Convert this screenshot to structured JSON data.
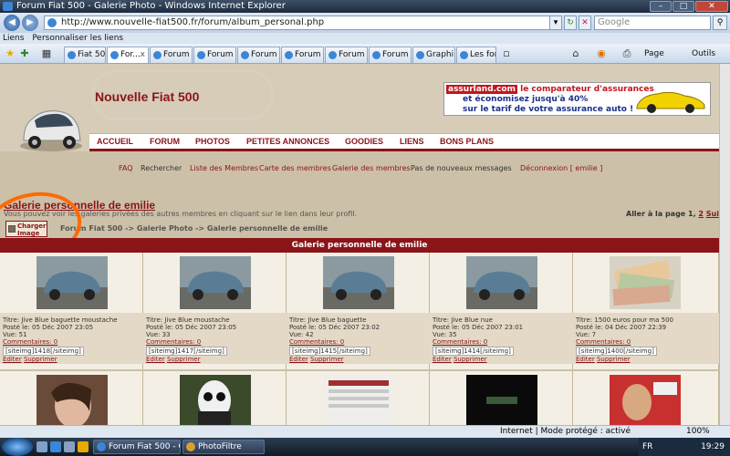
{
  "window": {
    "title": "Forum Fiat 500 - Galerie Photo - Windows Internet Explorer",
    "controls": [
      "–",
      "□",
      "✕"
    ]
  },
  "address": {
    "url": "http://www.nouvelle-fiat500.fr/forum/album_personal.php",
    "search_placeholder": "Google"
  },
  "links_bar": [
    "Liens",
    "Personnaliser les liens"
  ],
  "tabs": [
    {
      "label": "Fiat 50..."
    },
    {
      "label": "For..."
    },
    {
      "label": "Forum ..."
    },
    {
      "label": "Forum ..."
    },
    {
      "label": "Forum ..."
    },
    {
      "label": "Forum ..."
    },
    {
      "label": "Forum ..."
    },
    {
      "label": "Forum ..."
    },
    {
      "label": "Graphi..."
    },
    {
      "label": "Les for..."
    }
  ],
  "toolbar": {
    "page_label": "Page",
    "tools_label": "Outils"
  },
  "site": {
    "logo_text": "Nouvelle Fiat 500",
    "banner": {
      "brand": "assurland",
      "brand_suffix": ".com",
      "line1": "le comparateur d'assurances",
      "line2": "et économisez jusqu'à 40%",
      "line3": "sur le tarif de votre assurance auto !"
    },
    "menu": [
      "ACCUEIL",
      "FORUM",
      "PHOTOS",
      "PETITES ANNONCES",
      "GOODIES",
      "LIENS",
      "BONS PLANS"
    ],
    "submenu": [
      "FAQ",
      "Rechercher",
      "Liste des Membres",
      "Carte des membres",
      "Galerie des membres",
      "Pas de nouveaux messages",
      "Déconnexion [ emilie ]"
    ],
    "gallery": {
      "title": "Galerie personnelle de emilie",
      "description": "Vous pouvez voir les galeries privées des autres membres en cliquant sur le lien dans leur profil.",
      "page_info": "Aller à la page 1,",
      "page_2": "2",
      "next": "Suivante",
      "upload_label": "Charger Image",
      "breadcrumb": "Forum Fiat 500 -> Galerie Photo -> Galerie personnelle de emilie",
      "bar_title": "Galerie personnelle de emilie"
    },
    "photos": [
      {
        "title": "Titre: Jive Blue baguette moustache",
        "posted": "Posté le: 05 Déc 2007 23:05",
        "views": "Vue: 51",
        "comments": "Commentaires: 0",
        "tag": "[siteimg]1418[/siteimg]",
        "edit": "Editer",
        "delete": "Supprimer"
      },
      {
        "title": "Titre: Jive Blue moustache",
        "posted": "Posté le: 05 Déc 2007 23:05",
        "views": "Vue: 33",
        "comments": "Commentaires: 0",
        "tag": "[siteimg]1417[/siteimg]",
        "edit": "Editer",
        "delete": "Supprimer"
      },
      {
        "title": "Titre: Jive Blue baguette",
        "posted": "Posté le: 05 Déc 2007 23:02",
        "views": "Vue: 42",
        "comments": "Commentaires: 0",
        "tag": "[siteimg]1415[/siteimg]",
        "edit": "Editer",
        "delete": "Supprimer"
      },
      {
        "title": "Titre: Jive Blue nue",
        "posted": "Posté le: 05 Déc 2007 23:01",
        "views": "Vue: 35",
        "comments": "Commentaires: 0",
        "tag": "[siteimg]1414[/siteimg]",
        "edit": "Editer",
        "delete": "Supprimer"
      },
      {
        "title": "Titre: 1500 euros pour ma 500",
        "posted": "Posté le: 04 Déc 2007 22:39",
        "views": "Vue: 7",
        "comments": "Commentaires: 0",
        "tag": "[siteimg]1400[/siteimg]",
        "edit": "Editer",
        "delete": "Supprimer"
      }
    ]
  },
  "status": {
    "zone": "Internet | Mode protégé : activé",
    "zoom": "100%"
  },
  "taskbar": {
    "items": [
      "Forum Fiat 500 - Gal...",
      "PhotoFiltre"
    ],
    "lang": "FR",
    "clock": "19:29"
  }
}
